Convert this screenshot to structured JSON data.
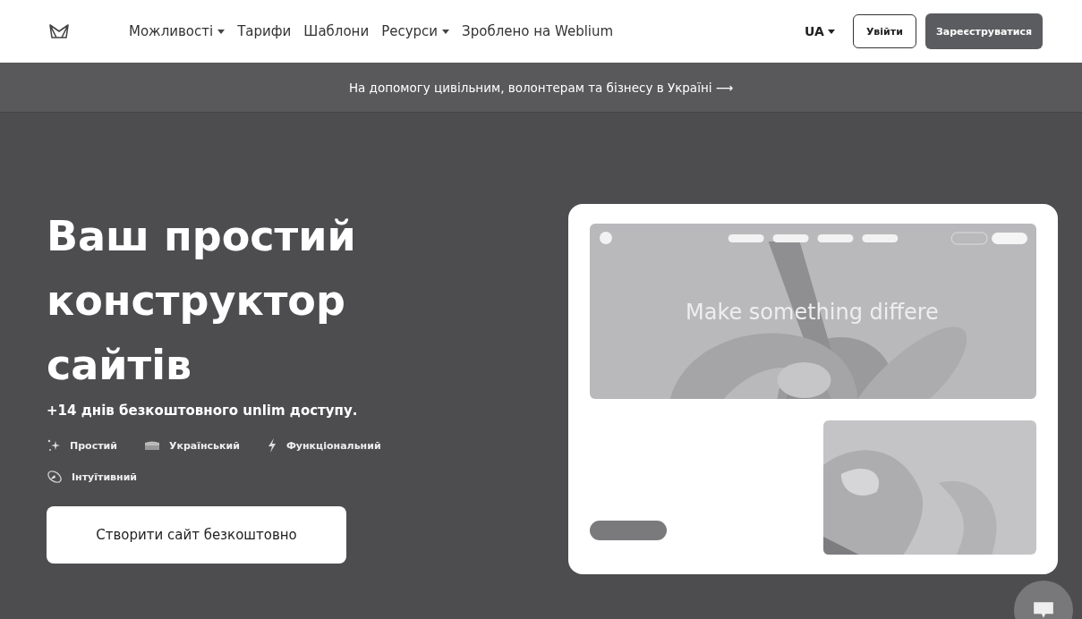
{
  "nav": {
    "items": [
      {
        "label": "Можливості",
        "dropdown": true
      },
      {
        "label": "Тарифи",
        "dropdown": false
      },
      {
        "label": "Шаблони",
        "dropdown": false
      },
      {
        "label": "Ресурси",
        "dropdown": true
      },
      {
        "label": "Зроблено на Weblium",
        "dropdown": false
      }
    ],
    "language": "UA",
    "login": "Увійти",
    "signup": "Зареєструватися"
  },
  "banner": {
    "text": "На допомогу цивільним, волонтерам та бізнесу в Україні",
    "arrow": "⟶"
  },
  "hero": {
    "title_lines": [
      "Ваш простий",
      "конструктор",
      "сайтів"
    ],
    "subtitle": "+14 днів безкоштовного unlim доступу.",
    "features": [
      {
        "kind": "sparkle",
        "label": "Простий"
      },
      {
        "kind": "flag",
        "label": "Український"
      },
      {
        "kind": "bolt",
        "label": "Функціональний"
      },
      {
        "kind": "satellite",
        "label": "Інтуїтивний"
      }
    ],
    "cta": "Створити сайт безкоштовно"
  },
  "preview": {
    "headline": "Make something differe"
  }
}
